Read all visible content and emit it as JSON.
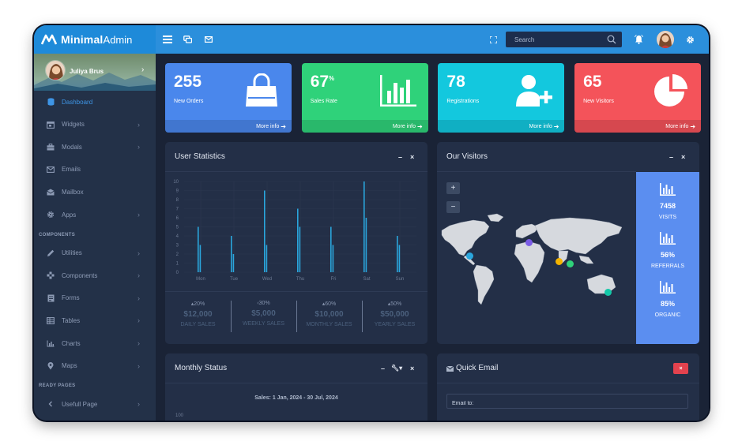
{
  "app": {
    "brand_bold": "Minimal",
    "brand_light": "Admin"
  },
  "header": {
    "search_placeholder": "Search"
  },
  "user": {
    "name": "Juliya Brus"
  },
  "sidebar": {
    "items": [
      {
        "label": "Dashboard",
        "icon": "database-icon",
        "has_chevron": false,
        "active": true
      },
      {
        "label": "Widgets",
        "icon": "calendar-icon",
        "has_chevron": true
      },
      {
        "label": "Modals",
        "icon": "briefcase-icon",
        "has_chevron": true
      },
      {
        "label": "Emails",
        "icon": "envelope-icon",
        "has_chevron": false
      },
      {
        "label": "Mailbox",
        "icon": "inbox-icon",
        "has_chevron": false
      },
      {
        "label": "Apps",
        "icon": "gear-icon",
        "has_chevron": true
      }
    ],
    "section_components": "COMPONENTS",
    "component_items": [
      {
        "label": "Utilities",
        "icon": "pencil-icon",
        "has_chevron": true
      },
      {
        "label": "Components",
        "icon": "puzzle-icon",
        "has_chevron": true
      },
      {
        "label": "Forms",
        "icon": "form-icon",
        "has_chevron": true
      },
      {
        "label": "Tables",
        "icon": "table-icon",
        "has_chevron": true
      },
      {
        "label": "Charts",
        "icon": "bar-chart-icon",
        "has_chevron": true
      },
      {
        "label": "Maps",
        "icon": "map-pin-icon",
        "has_chevron": true
      }
    ],
    "section_pages": "READY PAGES",
    "page_items": [
      {
        "label": "Usefull Page",
        "icon": "angle-left-icon",
        "has_chevron": true
      }
    ]
  },
  "stat_cards": [
    {
      "value": "255",
      "suffix": "",
      "label": "New Orders",
      "more": "More info",
      "color": "#4a87ec",
      "icon": "shopping-bag-icon"
    },
    {
      "value": "67",
      "suffix": "%",
      "label": "Sales Rate",
      "more": "More info",
      "color": "#2fd27a",
      "icon": "bar-chart-icon"
    },
    {
      "value": "78",
      "suffix": "",
      "label": "Registrations",
      "more": "More info",
      "color": "#13c8de",
      "icon": "user-plus-icon"
    },
    {
      "value": "65",
      "suffix": "",
      "label": "New Visitors",
      "more": "More info",
      "color": "#f4535a",
      "icon": "pie-chart-icon"
    }
  ],
  "user_statistics": {
    "title": "User Statistics",
    "stats": [
      {
        "pct": "20%",
        "direction": "up",
        "amount": "$12,000",
        "caption": "DAILY SALES"
      },
      {
        "pct": "30%",
        "direction": "left",
        "amount": "$5,000",
        "caption": "WEEKLY SALES"
      },
      {
        "pct": "60%",
        "direction": "up",
        "amount": "$10,000",
        "caption": "MONTHLY SALES"
      },
      {
        "pct": "50%",
        "direction": "up",
        "amount": "$50,000",
        "caption": "YEARLY SALES"
      }
    ]
  },
  "chart_data": {
    "type": "bar",
    "categories": [
      "Mon",
      "Tue",
      "Wed",
      "Thu",
      "Fri",
      "Sat",
      "Sun"
    ],
    "series": [
      {
        "values": [
          5,
          4,
          9,
          7,
          5,
          10,
          4
        ]
      },
      {
        "values": [
          3,
          2,
          3,
          5,
          3,
          6,
          3
        ]
      }
    ],
    "yticks": [
      0,
      1,
      2,
      3,
      4,
      5,
      6,
      7,
      8,
      9,
      10
    ],
    "ylim": [
      0,
      10
    ],
    "grid": true,
    "bar_color": "#2aa6dd"
  },
  "visitors": {
    "title": "Our Visitors",
    "zoom_in": "+",
    "zoom_out": "−",
    "side": [
      {
        "value": "7458",
        "caption": "VISITS"
      },
      {
        "value": "56%",
        "caption": "REFERRALS"
      },
      {
        "value": "85%",
        "caption": "ORGANIC"
      }
    ],
    "marker_colors": [
      "#7b5ce6",
      "#2aa6dd",
      "#f4b400",
      "#2fd27a",
      "#13c8a8"
    ]
  },
  "monthly_status": {
    "title": "Monthly Status",
    "subtitle": "Sales: 1 Jan, 2024 - 30 Jul, 2024",
    "first_tick": "100"
  },
  "quick_email": {
    "title": "Quick Email",
    "email_placeholder": "Email to:",
    "close_label": "×"
  }
}
